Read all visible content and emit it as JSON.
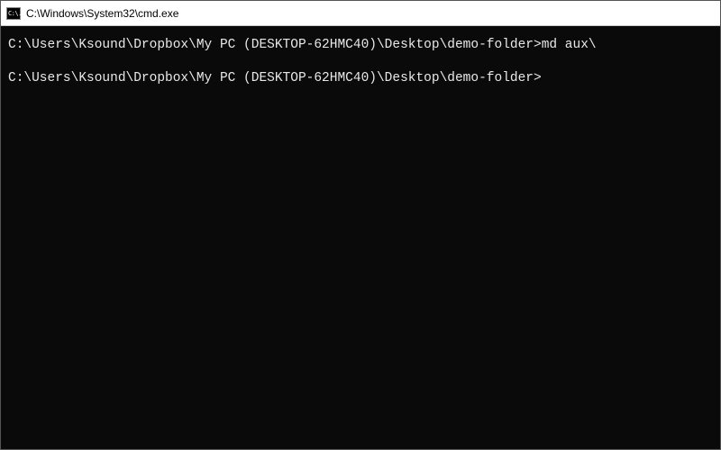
{
  "titlebar": {
    "icon_label": "C:\\.",
    "title": "C:\\Windows\\System32\\cmd.exe"
  },
  "terminal": {
    "lines": [
      {
        "prompt": "C:\\Users\\Ksound\\Dropbox\\My PC (DESKTOP-62HMC40)\\Desktop\\demo-folder>",
        "command": "md aux\\"
      },
      {
        "prompt": "C:\\Users\\Ksound\\Dropbox\\My PC (DESKTOP-62HMC40)\\Desktop\\demo-folder>",
        "command": ""
      }
    ]
  }
}
